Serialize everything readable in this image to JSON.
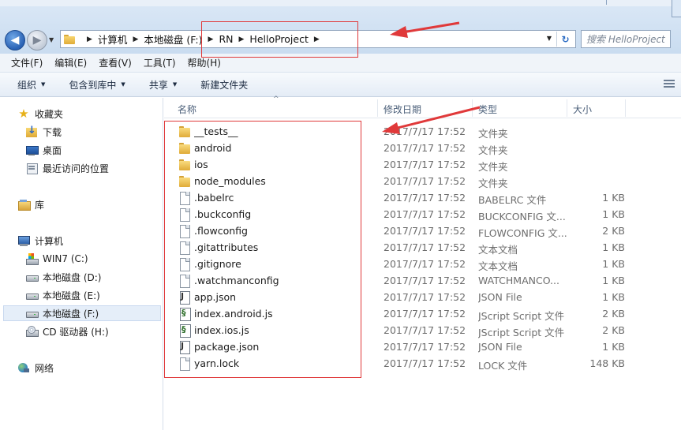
{
  "address": {
    "crumbs": [
      "计算机",
      "本地磁盘 (F:)",
      "RN",
      "HelloProject"
    ],
    "search_placeholder": "搜索 HelloProject"
  },
  "menu": [
    "文件(F)",
    "编辑(E)",
    "查看(V)",
    "工具(T)",
    "帮助(H)"
  ],
  "commands": {
    "organize": "组织",
    "include_in_library": "包含到库中",
    "share": "共享",
    "new_folder": "新建文件夹"
  },
  "sidebar": {
    "favorites": "收藏夹",
    "downloads": "下载",
    "desktop": "桌面",
    "recent": "最近访问的位置",
    "libraries": "库",
    "computer": "计算机",
    "drive_c": "WIN7 (C:)",
    "drive_d": "本地磁盘 (D:)",
    "drive_e": "本地磁盘 (E:)",
    "drive_f": "本地磁盘 (F:)",
    "drive_h": "CD 驱动器 (H:)",
    "network": "网络"
  },
  "columns": {
    "name": "名称",
    "date": "修改日期",
    "type": "类型",
    "size": "大小"
  },
  "files": [
    {
      "name": "__tests__",
      "date": "2017/7/17 17:52",
      "type": "文件夹",
      "size": "",
      "icon": "folder"
    },
    {
      "name": "android",
      "date": "2017/7/17 17:52",
      "type": "文件夹",
      "size": "",
      "icon": "folder"
    },
    {
      "name": "ios",
      "date": "2017/7/17 17:52",
      "type": "文件夹",
      "size": "",
      "icon": "folder"
    },
    {
      "name": "node_modules",
      "date": "2017/7/17 17:52",
      "type": "文件夹",
      "size": "",
      "icon": "folder"
    },
    {
      "name": ".babelrc",
      "date": "2017/7/17 17:52",
      "type": "BABELRC 文件",
      "size": "1 KB",
      "icon": "file"
    },
    {
      "name": ".buckconfig",
      "date": "2017/7/17 17:52",
      "type": "BUCKCONFIG 文...",
      "size": "1 KB",
      "icon": "file"
    },
    {
      "name": ".flowconfig",
      "date": "2017/7/17 17:52",
      "type": "FLOWCONFIG 文...",
      "size": "2 KB",
      "icon": "file"
    },
    {
      "name": ".gitattributes",
      "date": "2017/7/17 17:52",
      "type": "文本文档",
      "size": "1 KB",
      "icon": "file"
    },
    {
      "name": ".gitignore",
      "date": "2017/7/17 17:52",
      "type": "文本文档",
      "size": "1 KB",
      "icon": "file"
    },
    {
      "name": ".watchmanconfig",
      "date": "2017/7/17 17:52",
      "type": "WATCHMANCO...",
      "size": "1 KB",
      "icon": "file"
    },
    {
      "name": "app.json",
      "date": "2017/7/17 17:52",
      "type": "JSON File",
      "size": "1 KB",
      "icon": "json"
    },
    {
      "name": "index.android.js",
      "date": "2017/7/17 17:52",
      "type": "JScript Script 文件",
      "size": "2 KB",
      "icon": "js"
    },
    {
      "name": "index.ios.js",
      "date": "2017/7/17 17:52",
      "type": "JScript Script 文件",
      "size": "2 KB",
      "icon": "js"
    },
    {
      "name": "package.json",
      "date": "2017/7/17 17:52",
      "type": "JSON File",
      "size": "1 KB",
      "icon": "json"
    },
    {
      "name": "yarn.lock",
      "date": "2017/7/17 17:52",
      "type": "LOCK 文件",
      "size": "148 KB",
      "icon": "file"
    }
  ],
  "colors": {
    "annotation": "#e0393a",
    "accent": "#2b6cc4"
  }
}
